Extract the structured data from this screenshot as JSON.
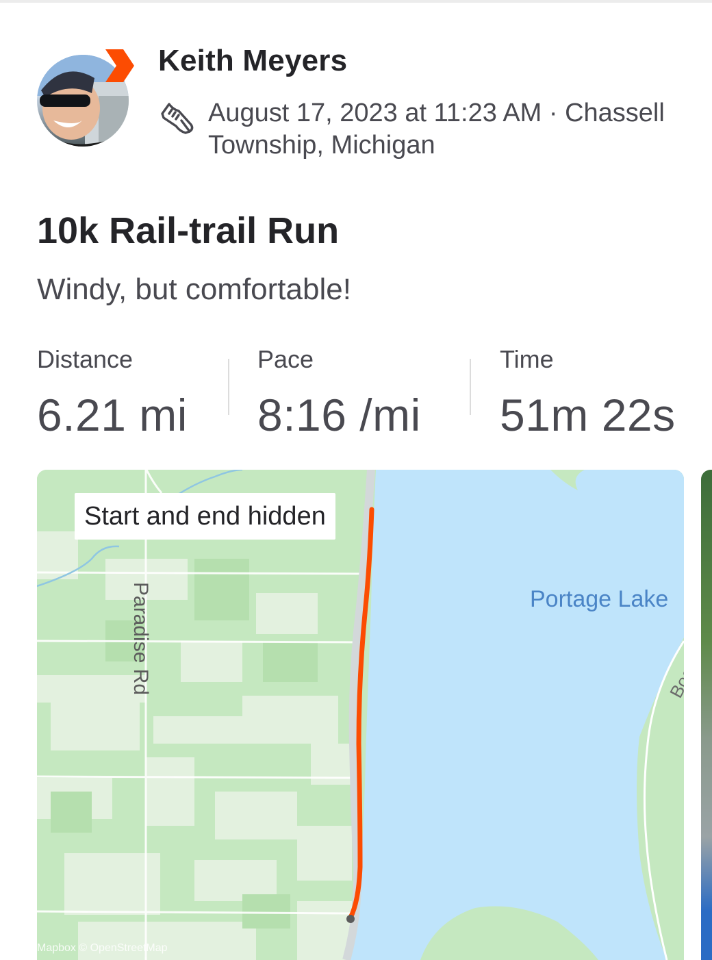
{
  "athlete": {
    "name": "Keith Meyers",
    "avatar_icon": "avatar-photo"
  },
  "activity": {
    "type_icon": "running-shoe-icon",
    "date_location": "August 17, 2023 at 11:23 AM · Chassell Township, Michigan",
    "title": "10k Rail-trail Run",
    "description": "Windy, but comfortable!"
  },
  "stats": [
    {
      "label": "Distance",
      "value": "6.21 mi"
    },
    {
      "label": "Pace",
      "value": "8:16 /mi"
    },
    {
      "label": "Time",
      "value": "51m 22s"
    }
  ],
  "map": {
    "privacy_label": "Start and end hidden",
    "road_label": "Paradise Rd",
    "lake_label": "Portage Lake",
    "road_label_2": "Boot",
    "attribution": "Mapbox © OpenStreetMap",
    "route_color": "#fc4c02",
    "water_color": "#bfe4fb",
    "land_color": "#c5e8c0"
  },
  "brand_color": "#fc4c02"
}
